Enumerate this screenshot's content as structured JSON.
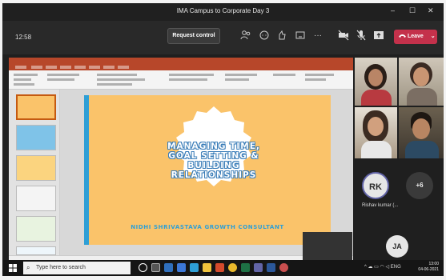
{
  "window": {
    "title": "IMA Campus to Corporate Day 3",
    "minimize": "–",
    "maximize": "☐",
    "close": "✕"
  },
  "meeting": {
    "time": "12:58",
    "request_control": "Request control",
    "leave": "Leave",
    "leave_chevron": "⌄",
    "more": "···",
    "icons": [
      "participants-icon",
      "chat-icon",
      "reactions-icon",
      "rooms-icon",
      "more-icon",
      "camera-off-icon",
      "mic-off-icon",
      "share-icon"
    ]
  },
  "slide": {
    "title": "MANAGING TIME, GOAL SETTING & BUILDING RELATIONSHIPS",
    "subtitle": "NIDHI SHRIVASTAVA GROWTH CONSULTANT",
    "colors": {
      "background": "#fac36a",
      "accent": "#2e9fd6",
      "badge": "#ffffff"
    }
  },
  "participants": {
    "more_count": "+6",
    "rk_initials": "RK",
    "rk_name": "Rishav kumar (...",
    "ja_initials": "JA"
  },
  "taskbar": {
    "search_placeholder": "Type here to search",
    "lang": "ENG",
    "time": "13:00",
    "date": "04-06-2021"
  }
}
